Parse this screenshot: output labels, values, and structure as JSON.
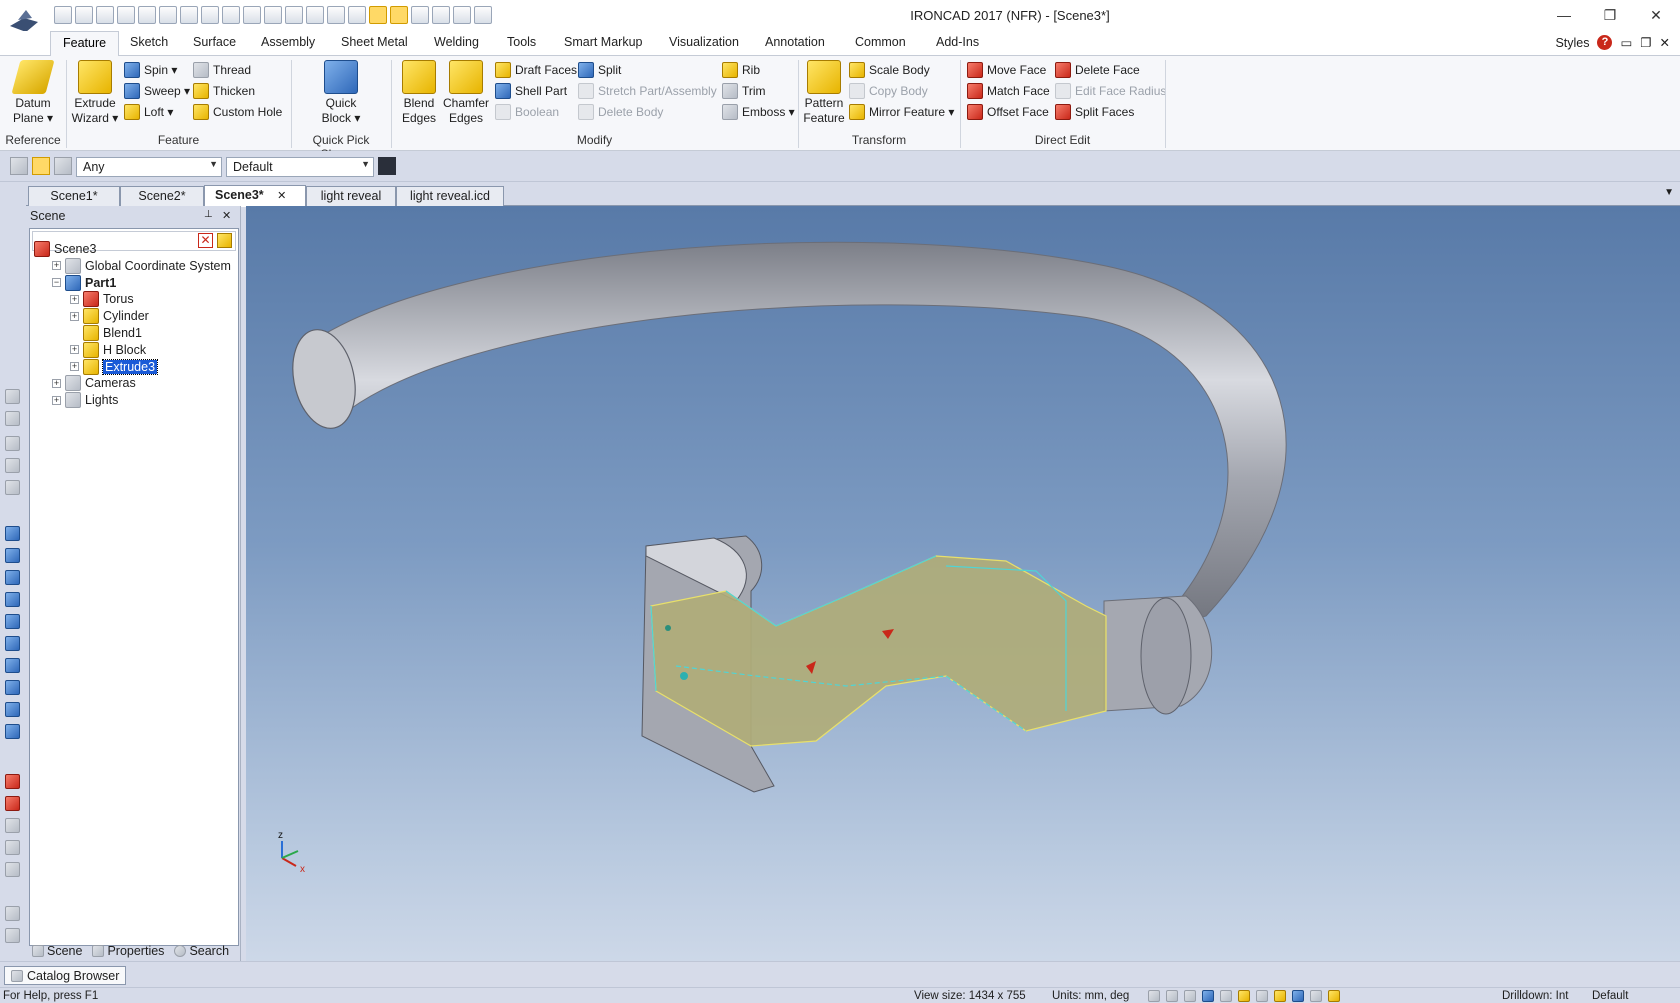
{
  "window": {
    "title": "IRONCAD 2017 (NFR) - [Scene3*]",
    "minimize": "—",
    "maximize": "❐",
    "close": "✕"
  },
  "ribbon_tabs": [
    "Feature",
    "Sketch",
    "Surface",
    "Assembly",
    "Sheet Metal",
    "Welding",
    "Tools",
    "Smart Markup",
    "Visualization",
    "Annotation",
    "Common",
    "Add-Ins"
  ],
  "styles_label": "Styles",
  "help_glyph": "?",
  "ribbon": {
    "reference": {
      "label": "Reference",
      "datum_plane": [
        "Datum",
        "Plane ▾"
      ]
    },
    "feature": {
      "label": "Feature",
      "extrude_wizard": [
        "Extrude",
        "Wizard ▾"
      ],
      "spin": "Spin ▾",
      "sweep": "Sweep ▾",
      "loft": "Loft ▾",
      "thread": "Thread",
      "thicken": "Thicken",
      "custom_hole": "Custom Hole"
    },
    "quick_pick": {
      "label": "Quick Pick Shapes",
      "quick_block": [
        "Quick",
        "Block ▾"
      ]
    },
    "modify": {
      "label": "Modify",
      "blend_edges": [
        "Blend",
        "Edges"
      ],
      "chamfer_edges": [
        "Chamfer",
        "Edges"
      ],
      "draft_faces": "Draft Faces",
      "shell_part": "Shell Part",
      "boolean": "Boolean",
      "split": "Split",
      "stretch": "Stretch Part/Assembly",
      "delete_body": "Delete Body",
      "rib": "Rib",
      "trim": "Trim",
      "emboss": "Emboss ▾"
    },
    "transform": {
      "label": "Transform",
      "pattern_feature": [
        "Pattern",
        "Feature"
      ],
      "scale_body": "Scale Body",
      "copy_body": "Copy Body",
      "mirror_feature": "Mirror Feature ▾"
    },
    "direct_edit": {
      "label": "Direct Edit",
      "move_face": "Move Face",
      "match_face": "Match Face",
      "offset_face": "Offset Face",
      "delete_face": "Delete Face",
      "edit_face_radius": "Edit Face Radius",
      "split_faces": "Split Faces"
    }
  },
  "selection": {
    "filter": "Any",
    "style": "Default"
  },
  "doc_tabs": [
    "Scene1*",
    "Scene2*",
    "Scene3*",
    "light reveal",
    "light reveal.icd"
  ],
  "doc_tab_close": "✕",
  "scene_panel": {
    "title": "Scene",
    "pin": "📌",
    "close": "✕",
    "tree": [
      {
        "label": "Scene3",
        "level": 0,
        "expander": ""
      },
      {
        "label": "Global Coordinate System",
        "level": 1,
        "expander": "+"
      },
      {
        "label": "Part1",
        "level": 1,
        "expander": "−",
        "bold": true
      },
      {
        "label": "Torus",
        "level": 2,
        "expander": "+"
      },
      {
        "label": "Cylinder",
        "level": 2,
        "expander": "+"
      },
      {
        "label": "Blend1",
        "level": 2,
        "expander": ""
      },
      {
        "label": "H Block",
        "level": 2,
        "expander": "+"
      },
      {
        "label": "Extrude3",
        "level": 2,
        "expander": "+",
        "selected": true
      },
      {
        "label": "Cameras",
        "level": 1,
        "expander": "+"
      },
      {
        "label": "Lights",
        "level": 1,
        "expander": "+"
      }
    ],
    "tabs": [
      "Scene",
      "Properties",
      "Search"
    ]
  },
  "viewport": {
    "axis_z": "z",
    "axis_x": "x"
  },
  "catalog_browser": "Catalog Browser",
  "status": {
    "help": "For Help, press F1",
    "view_size": "View size: 1434 x  755",
    "units": "Units: mm, deg",
    "drilldown": "Drilldown: Int",
    "style": "Default"
  },
  "colors": {
    "accent": "#1a5ad7",
    "viewport_top": "#587aa8",
    "selection": "#e8e06a"
  }
}
